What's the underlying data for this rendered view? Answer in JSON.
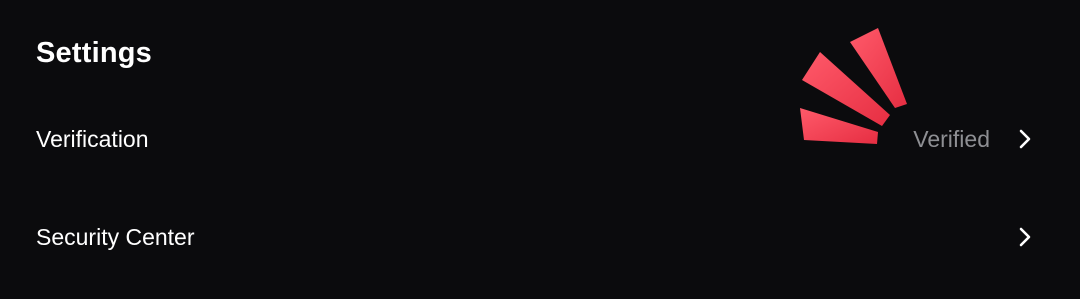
{
  "page": {
    "title": "Settings"
  },
  "rows": [
    {
      "label": "Verification",
      "value": "Verified",
      "icon": "chevron-right-icon"
    },
    {
      "label": "Security Center",
      "value": "",
      "icon": "chevron-right-icon"
    }
  ],
  "decoration": {
    "icon": "highlight-burst-icon",
    "color": "#f23d4f"
  },
  "colors": {
    "background": "#0b0b0d",
    "text": "#ffffff",
    "muted_text": "#8e8f93"
  }
}
